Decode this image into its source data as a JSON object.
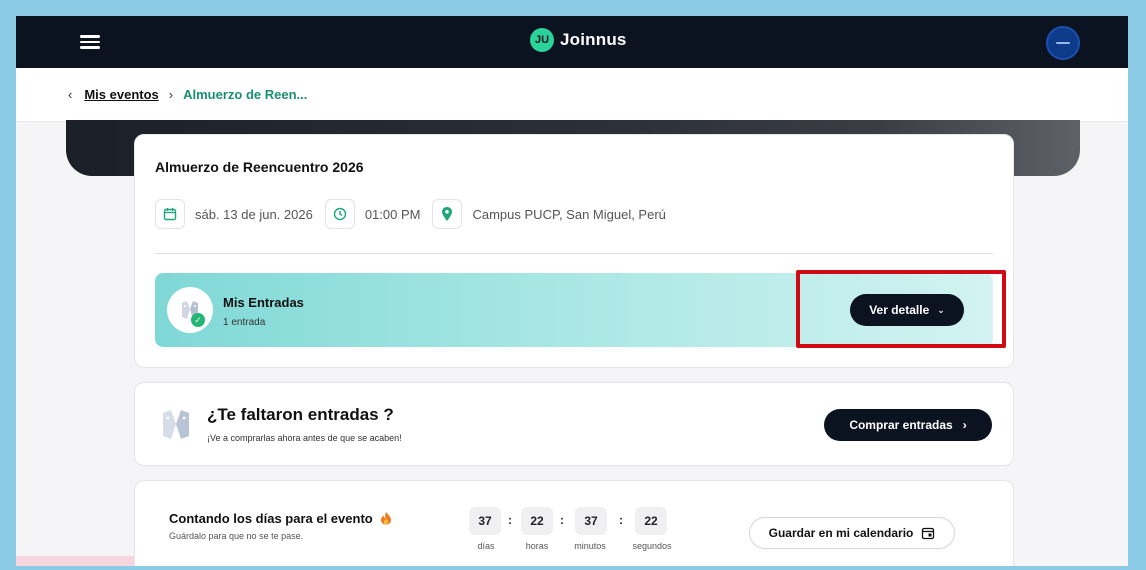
{
  "header": {
    "brand": "Joinnus",
    "logo_mark": "JU"
  },
  "breadcrumb": {
    "back_icon": "chevron-left-icon",
    "parent": "Mis eventos",
    "separator": "›",
    "current": "Almuerzo de Reen..."
  },
  "event": {
    "title": "Almuerzo de Reencuentro 2026",
    "date": "sáb. 13 de jun. 2026",
    "time": "01:00 PM",
    "location": "Campus PUCP, San Miguel, Perú"
  },
  "entradas": {
    "title": "Mis Entradas",
    "subtitle": "1 entrada",
    "button": "Ver detalle",
    "button_icon": "chevron-down-icon"
  },
  "faltaron": {
    "title": "¿Te faltaron entradas ?",
    "subtitle": "¡Ve a comprarlas ahora antes de que se acaben!",
    "button": "Comprar entradas",
    "button_icon": "chevron-right-icon"
  },
  "countdown": {
    "title": "Contando los días para el evento",
    "title_icon": "fire-icon",
    "subtitle": "Guárdalo para que no se te pase.",
    "units": [
      {
        "value": "37",
        "label": "días"
      },
      {
        "value": "22",
        "label": "horas"
      },
      {
        "value": "37",
        "label": "minutos"
      },
      {
        "value": "22",
        "label": "segundos"
      }
    ],
    "calendar_button": "Guardar en mi calendario"
  },
  "colors": {
    "topbar": "#0b1220",
    "accent_green": "#1a8f6e",
    "highlight_red": "#cf0a14",
    "entradas_gradient_start": "#7fd8d6"
  }
}
